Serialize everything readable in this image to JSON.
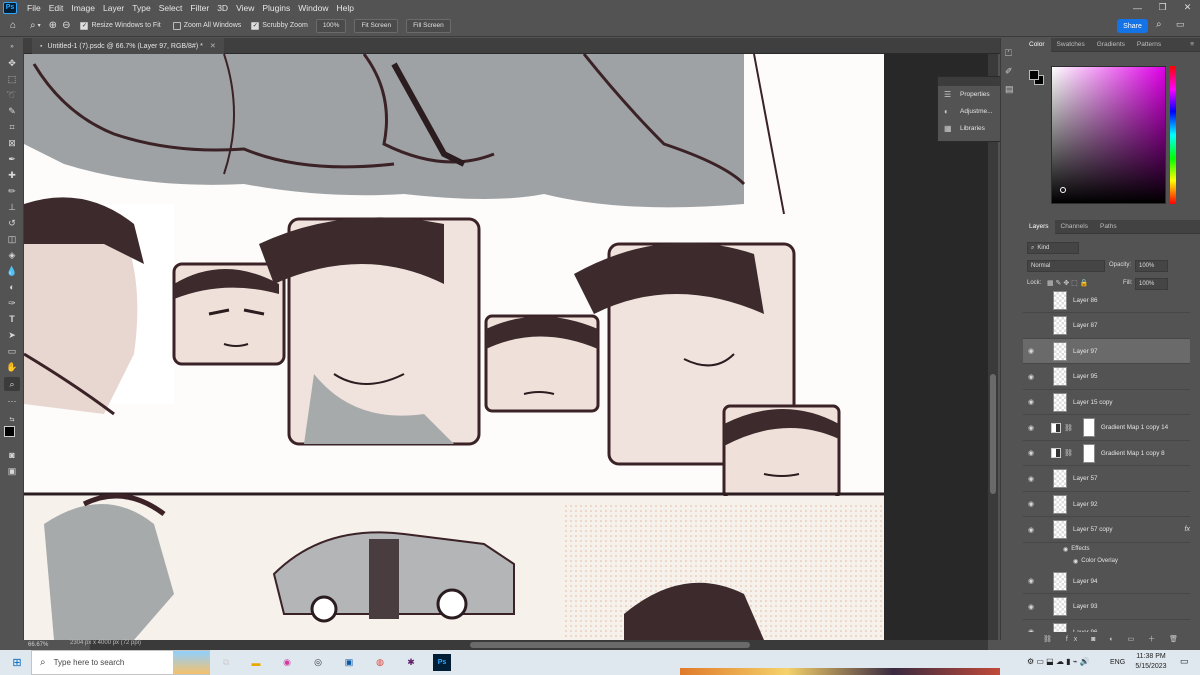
{
  "app": {
    "logo": "Ps"
  },
  "menu": [
    "File",
    "Edit",
    "Image",
    "Layer",
    "Type",
    "Select",
    "Filter",
    "3D",
    "View",
    "Plugins",
    "Window",
    "Help"
  ],
  "options_bar": {
    "resize_windows": "Resize Windows to Fit",
    "zoom_all": "Zoom All Windows",
    "scrubby": "Scrubby Zoom",
    "zoom_value": "100%",
    "fit_screen": "Fit Screen",
    "fill_screen": "Fill Screen",
    "share": "Share"
  },
  "document": {
    "tab_title": "Untitled-1 (7).psdc @ 66.7% (Layer 97, RGB/8#) *",
    "zoom_status": "66.67%",
    "doc_info": "2304 px x 4000 px (72 ppi)"
  },
  "float_panel": {
    "items": [
      "Properties",
      "Adjustme...",
      "Libraries"
    ]
  },
  "color_panel": {
    "tabs": [
      "Color",
      "Swatches",
      "Gradients",
      "Patterns"
    ]
  },
  "layers_panel": {
    "tabs": [
      "Layers",
      "Channels",
      "Paths"
    ],
    "kind": "Kind",
    "blend_mode": "Normal",
    "opacity_label": "Opacity:",
    "opacity_value": "100%",
    "lock_label": "Lock:",
    "fill_label": "Fill:",
    "fill_value": "100%",
    "layers": [
      {
        "name": "Layer 86",
        "visible": false,
        "type": "pixel"
      },
      {
        "name": "Layer 87",
        "visible": false,
        "type": "pixel"
      },
      {
        "name": "Layer 97",
        "visible": true,
        "type": "pixel",
        "selected": true
      },
      {
        "name": "Layer 95",
        "visible": true,
        "type": "pixel"
      },
      {
        "name": "Layer 15 copy",
        "visible": true,
        "type": "pixel"
      },
      {
        "name": "Gradient Map 1 copy 14",
        "visible": true,
        "type": "adjustment"
      },
      {
        "name": "Gradient Map 1 copy 8",
        "visible": true,
        "type": "adjustment"
      },
      {
        "name": "Layer 57",
        "visible": true,
        "type": "pixel"
      },
      {
        "name": "Layer 92",
        "visible": true,
        "type": "pixel"
      },
      {
        "name": "Layer 57 copy",
        "visible": true,
        "type": "pixel",
        "fx": "fx"
      },
      {
        "name": "Layer 94",
        "visible": true,
        "type": "pixel"
      },
      {
        "name": "Layer 93",
        "visible": true,
        "type": "pixel"
      },
      {
        "name": "Layer 96",
        "visible": true,
        "type": "pixel"
      }
    ],
    "effects_label": "Effects",
    "color_overlay_label": "Color Overlay"
  },
  "taskbar": {
    "search_placeholder": "Type here to search",
    "lang": "ENG",
    "time": "11:38 PM",
    "date": "5/15/2023"
  },
  "colors": {
    "accent": "#1473e6",
    "panel_bg": "#535353",
    "canvas_bg": "#282828"
  }
}
